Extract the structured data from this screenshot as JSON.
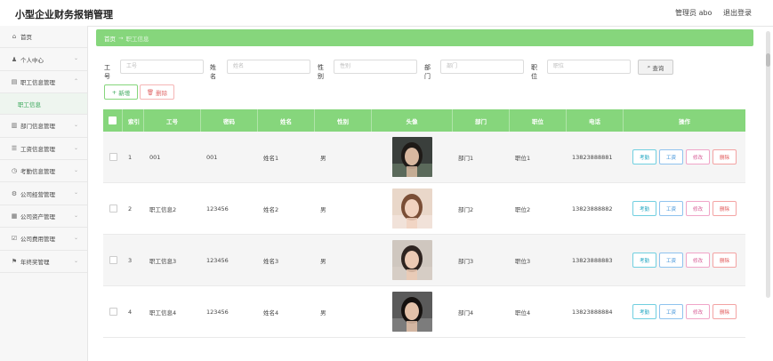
{
  "header": {
    "title": "小型企业财务报销管理",
    "user": "管理员 abo",
    "logout": "退出登录"
  },
  "sidebar": {
    "items": [
      {
        "label": "首页",
        "icon": "home-icon",
        "glyph": "⌂",
        "chevron": false
      },
      {
        "label": "个人中心",
        "icon": "user-icon",
        "glyph": "♟",
        "chevron": true
      },
      {
        "label": "职工信息管理",
        "icon": "list-icon",
        "glyph": "▤",
        "chevron": true
      },
      {
        "label": "部门信息管理",
        "icon": "chart-icon",
        "glyph": "▥",
        "chevron": true
      },
      {
        "label": "工资信息管理",
        "icon": "sliders-icon",
        "glyph": "☰",
        "chevron": true
      },
      {
        "label": "考勤信息管理",
        "icon": "clock-icon",
        "glyph": "◷",
        "chevron": true
      },
      {
        "label": "公司经营管理",
        "icon": "gear-icon",
        "glyph": "⚙",
        "chevron": true
      },
      {
        "label": "公司资产管理",
        "icon": "building-icon",
        "glyph": "▦",
        "chevron": true
      },
      {
        "label": "公司费用管理",
        "icon": "check-icon",
        "glyph": "☑",
        "chevron": true
      },
      {
        "label": "年终奖管理",
        "icon": "flag-icon",
        "glyph": "⚑",
        "chevron": true
      }
    ],
    "sub_item": "职工信息"
  },
  "breadcrumb": {
    "home": "首页",
    "current": "职工信息"
  },
  "search": {
    "fields": [
      {
        "label": "工号",
        "placeholder": "工号"
      },
      {
        "label": "姓名",
        "placeholder": "姓名"
      },
      {
        "label": "性别",
        "placeholder": "性别"
      },
      {
        "label": "部门",
        "placeholder": "部门"
      },
      {
        "label": "职位",
        "placeholder": "职位"
      }
    ],
    "button": "查询"
  },
  "actions": {
    "add": "新增",
    "delete": "删除"
  },
  "table": {
    "headers": [
      "索引",
      "工号",
      "密码",
      "姓名",
      "性别",
      "头像",
      "部门",
      "职位",
      "电话",
      "操作"
    ],
    "row_buttons": {
      "attendance": "考勤",
      "salary": "工资",
      "edit": "修改",
      "delete": "删除"
    },
    "rows": [
      {
        "index": "1",
        "id": "001",
        "password": "001",
        "name": "姓名1",
        "gender": "男",
        "dept": "部门1",
        "position": "职位1",
        "phone": "13823888881"
      },
      {
        "index": "2",
        "id": "职工信息2",
        "password": "123456",
        "name": "姓名2",
        "gender": "男",
        "dept": "部门2",
        "position": "职位2",
        "phone": "13823888882"
      },
      {
        "index": "3",
        "id": "职工信息3",
        "password": "123456",
        "name": "姓名3",
        "gender": "男",
        "dept": "部门3",
        "position": "职位3",
        "phone": "13823888883"
      },
      {
        "index": "4",
        "id": "职工信息4",
        "password": "123456",
        "name": "姓名4",
        "gender": "男",
        "dept": "部门4",
        "position": "职位4",
        "phone": "13823888884"
      }
    ]
  },
  "colors": {
    "accent": "#86d67c",
    "accent_dark": "#3aa85a"
  }
}
